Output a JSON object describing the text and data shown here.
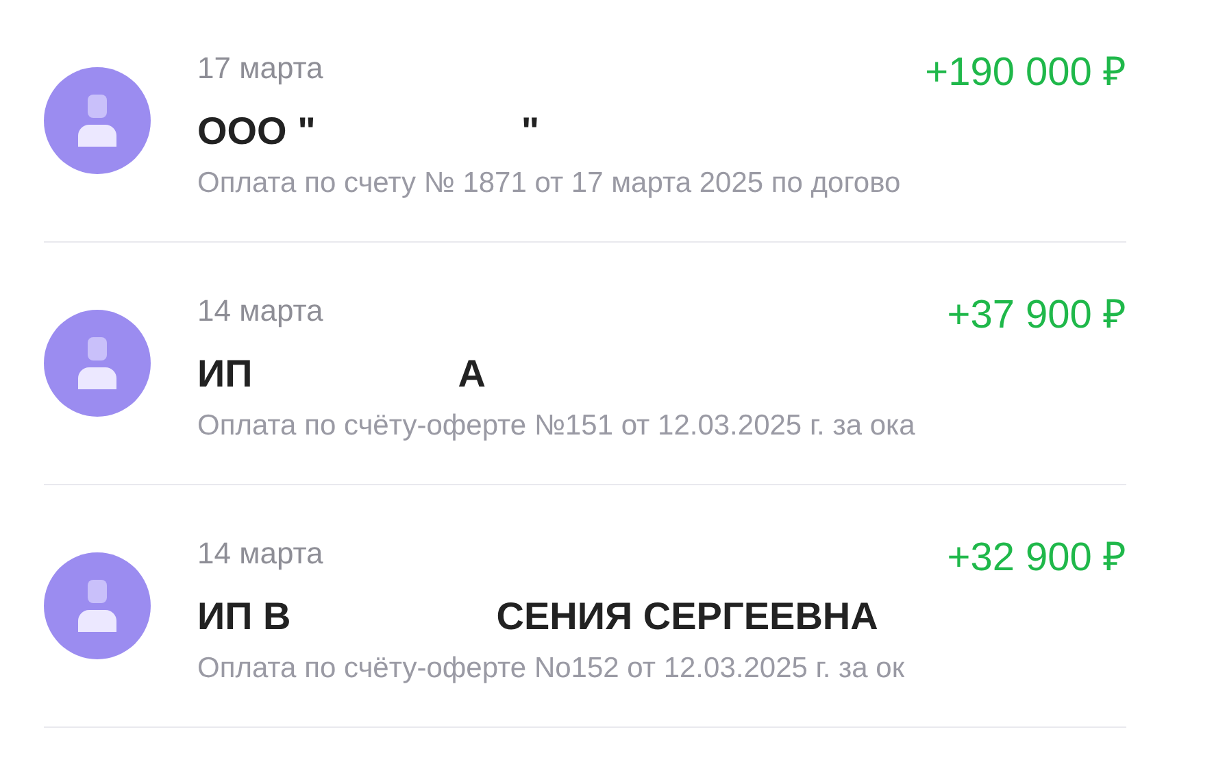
{
  "transactions": [
    {
      "date": "17 марта",
      "amount": "+190 000 ₽",
      "name_parts": [
        "ООО \"",
        "\""
      ],
      "description": "Оплата по счету № 1871 от 17 марта 2025 по догово"
    },
    {
      "date": "14 марта",
      "amount": "+37 900 ₽",
      "name_parts": [
        "ИП",
        "А"
      ],
      "description": "Оплата по счёту-оферте №151 от 12.03.2025 г. за ока"
    },
    {
      "date": "14 марта",
      "amount": "+32 900 ₽",
      "name_parts": [
        "ИП В",
        "СЕНИЯ СЕРГЕЕВНА"
      ],
      "description": "Оплата по счёту-оферте No152 от 12.03.2025 г. за ок"
    }
  ]
}
